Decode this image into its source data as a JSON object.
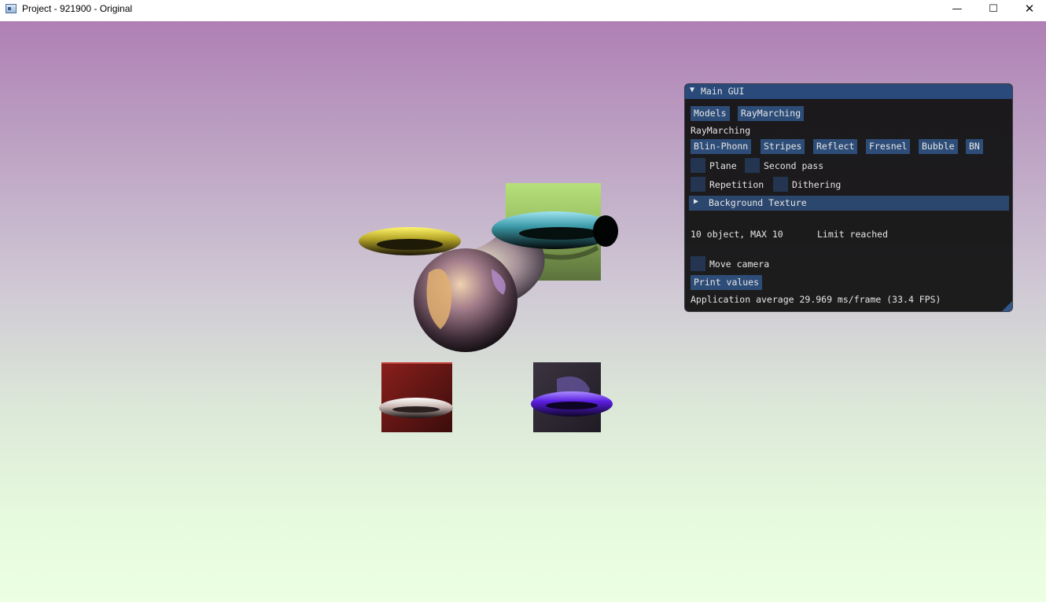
{
  "window": {
    "title": "Project - 921900 - Original",
    "icons": [
      "app-icon",
      "minimize-icon",
      "maximize-icon",
      "close-icon"
    ],
    "minimize_glyph": "—",
    "maximize_glyph": "☐",
    "close_glyph": "✕"
  },
  "viewport": {
    "background_colors": [
      "#af80b4",
      "#cfc7d4",
      "#ecffe3"
    ]
  },
  "gui": {
    "title": "Main GUI",
    "collapse_glyph": "▼",
    "tabs": [
      "Models",
      "RayMarching"
    ],
    "section_label": "RayMarching",
    "shading_buttons": [
      "Blin-Phonn",
      "Stripes",
      "Reflect",
      "Fresnel",
      "Bubble",
      "BN"
    ],
    "checkboxes": [
      {
        "label": "Plane",
        "checked": false
      },
      {
        "label": "Second pass",
        "checked": false
      },
      {
        "label": "Repetition",
        "checked": false
      },
      {
        "label": "Dithering",
        "checked": false
      }
    ],
    "background_texture": {
      "label": "Background Texture",
      "arrow": "▶",
      "expanded": false
    },
    "object_count": "10 object, MAX 10",
    "limit_status": "Limit reached",
    "move_camera": {
      "label": "Move camera",
      "checked": false
    },
    "print_values_label": "Print values",
    "fps_text": "Application average 29.969 ms/frame (33.4 FPS)",
    "accent_color": "#294a7a",
    "button_color": "#2d4d78"
  }
}
